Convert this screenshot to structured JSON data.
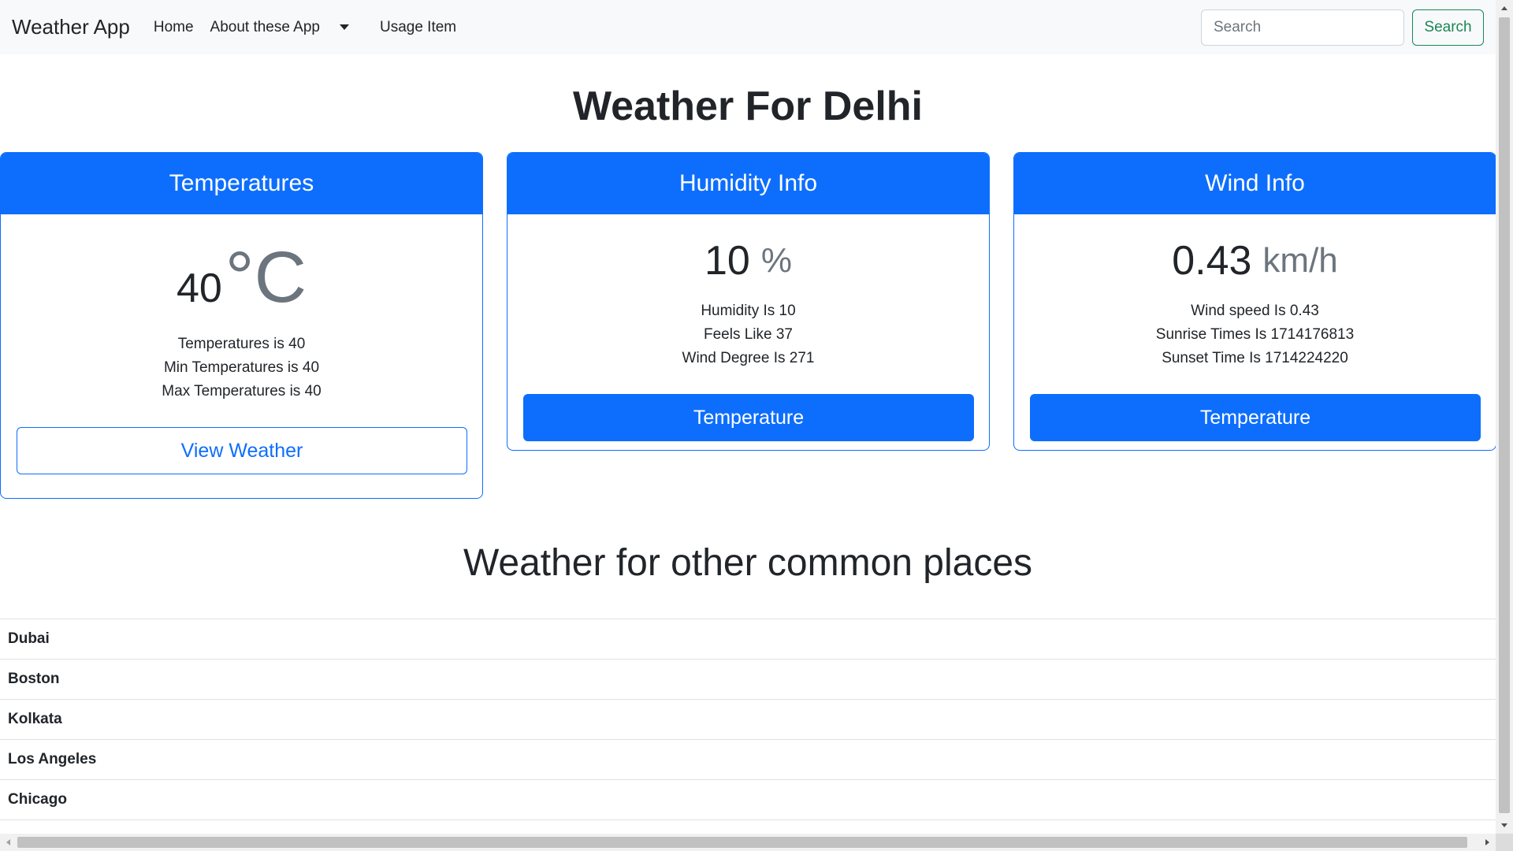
{
  "navbar": {
    "brand": "Weather App",
    "links": [
      "Home",
      "About these App"
    ],
    "dropdown_icon": "caret-down-icon",
    "usage_item": "Usage Item",
    "search_placeholder": "Search",
    "search_button": "Search"
  },
  "page_title": "Weather For Delhi",
  "cards": {
    "temperature": {
      "header": "Temperatures",
      "value": "40",
      "unit": "°C",
      "lines": [
        "Temperatures is 40",
        "Min Temperatures is 40",
        "Max Temperatures is 40"
      ],
      "button": "View Weather"
    },
    "humidity": {
      "header": "Humidity Info",
      "value": "10",
      "unit": "%",
      "lines": [
        "Humidity Is 10",
        "Feels Like 37",
        "Wind Degree Is 271"
      ],
      "button": "Temperature"
    },
    "wind": {
      "header": "Wind Info",
      "value": "0.43",
      "unit": "km/h",
      "lines": [
        "Wind speed Is 0.43",
        "Sunrise Times Is 1714176813",
        "Sunset Time Is 1714224220"
      ],
      "button": "Temperature"
    }
  },
  "other_places": {
    "title": "Weather for other common places",
    "items": [
      "Dubai",
      "Boston",
      "Kolkata",
      "Los Angeles",
      "Chicago"
    ]
  },
  "colors": {
    "primary": "#0d6efd",
    "success": "#198754",
    "navbar_bg": "#f8f9fa"
  }
}
